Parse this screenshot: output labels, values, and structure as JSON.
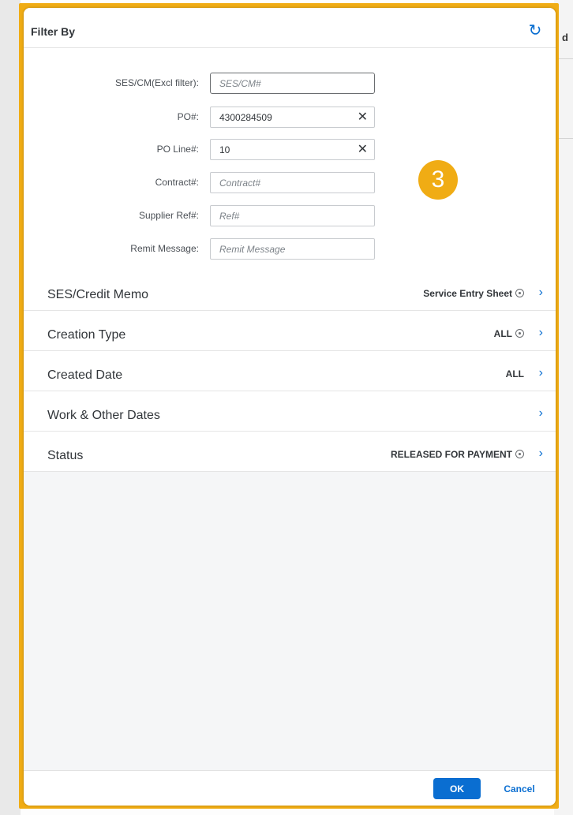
{
  "background": {
    "right_edge_fragment": "d"
  },
  "dialog": {
    "title": "Filter By",
    "refresh_icon": "refresh-icon",
    "accent_color": "#0a6ed1",
    "highlight_color": "#f0ac14",
    "step_badge": "3"
  },
  "fields": {
    "ses_cm": {
      "label": "SES/CM(Excl filter):",
      "value": "",
      "placeholder": "SES/CM#"
    },
    "po": {
      "label": "PO#:",
      "value": "4300284509",
      "placeholder": ""
    },
    "po_line": {
      "label": "PO Line#:",
      "value": "10",
      "placeholder": ""
    },
    "contract": {
      "label": "Contract#:",
      "value": "",
      "placeholder": "Contract#"
    },
    "supplier_ref": {
      "label": "Supplier Ref#:",
      "value": "",
      "placeholder": "Ref#"
    },
    "remit_message": {
      "label": "Remit Message:",
      "value": "",
      "placeholder": "Remit Message"
    }
  },
  "filters": [
    {
      "label": "SES/Credit Memo",
      "value": "Service Entry Sheet"
    },
    {
      "label": "Creation Type",
      "value": "ALL"
    },
    {
      "label": "Created Date",
      "value": "ALL"
    },
    {
      "label": "Work & Other Dates",
      "value": ""
    },
    {
      "label": "Status",
      "value": "RELEASED FOR PAYMENT"
    }
  ],
  "footer": {
    "ok_label": "OK",
    "cancel_label": "Cancel"
  }
}
